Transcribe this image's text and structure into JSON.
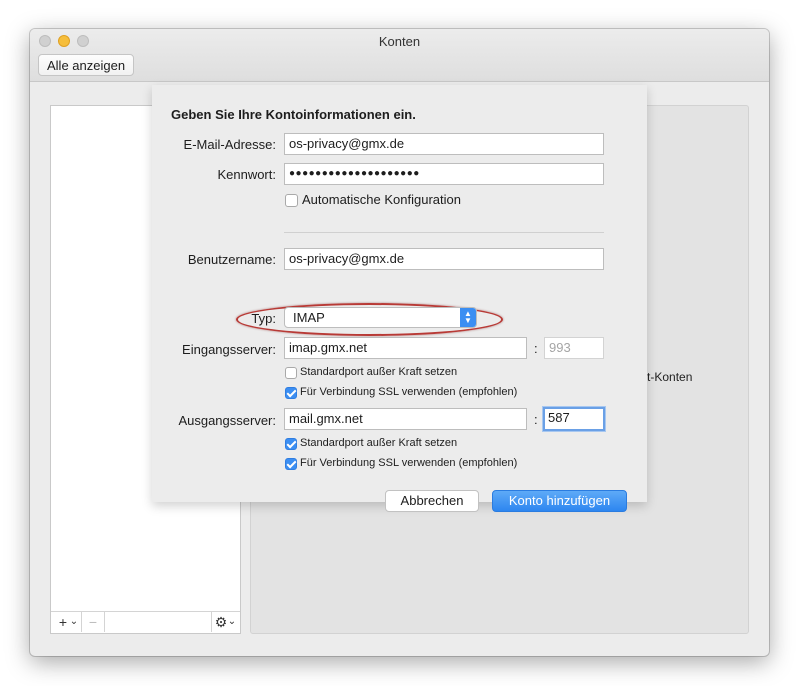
{
  "window": {
    "title": "Konten",
    "show_all_label": "Alle anzeigen"
  },
  "sidebar": {
    "add_label": "+",
    "add_chevron": "⌄",
    "remove_label": "−",
    "gear_label": "⚙",
    "gear_chevron": "⌄"
  },
  "right_panel": {
    "partial_text": "soft-Konten"
  },
  "form": {
    "heading": "Geben Sie Ihre Kontoinformationen ein.",
    "email_label": "E-Mail-Adresse:",
    "email_value": "os-privacy@gmx.de",
    "password_label": "Kennwort:",
    "password_value": "●●●●●●●●●●●●●●●●●●●●",
    "auto_config_label": "Automatische Konfiguration",
    "auto_config_checked": false,
    "username_label": "Benutzername:",
    "username_value": "os-privacy@gmx.de",
    "type_label": "Typ:",
    "type_value": "IMAP",
    "incoming_label": "Eingangsserver:",
    "incoming_value": "imap.gmx.net",
    "incoming_port": "993",
    "incoming_override_label": "Standardport außer Kraft setzen",
    "incoming_override_checked": false,
    "incoming_ssl_label": "Für Verbindung SSL verwenden (empfohlen)",
    "incoming_ssl_checked": true,
    "outgoing_label": "Ausgangsserver:",
    "outgoing_value": "mail.gmx.net",
    "outgoing_port": "587",
    "outgoing_override_label": "Standardport außer Kraft setzen",
    "outgoing_override_checked": true,
    "outgoing_ssl_label": "Für Verbindung SSL verwenden (empfohlen)",
    "outgoing_ssl_checked": true,
    "colon": ":",
    "cancel_label": "Abbrechen",
    "add_account_label": "Konto hinzufügen"
  },
  "colors": {
    "accent": "#3b8ef2",
    "highlight_oval": "#b83a36"
  }
}
